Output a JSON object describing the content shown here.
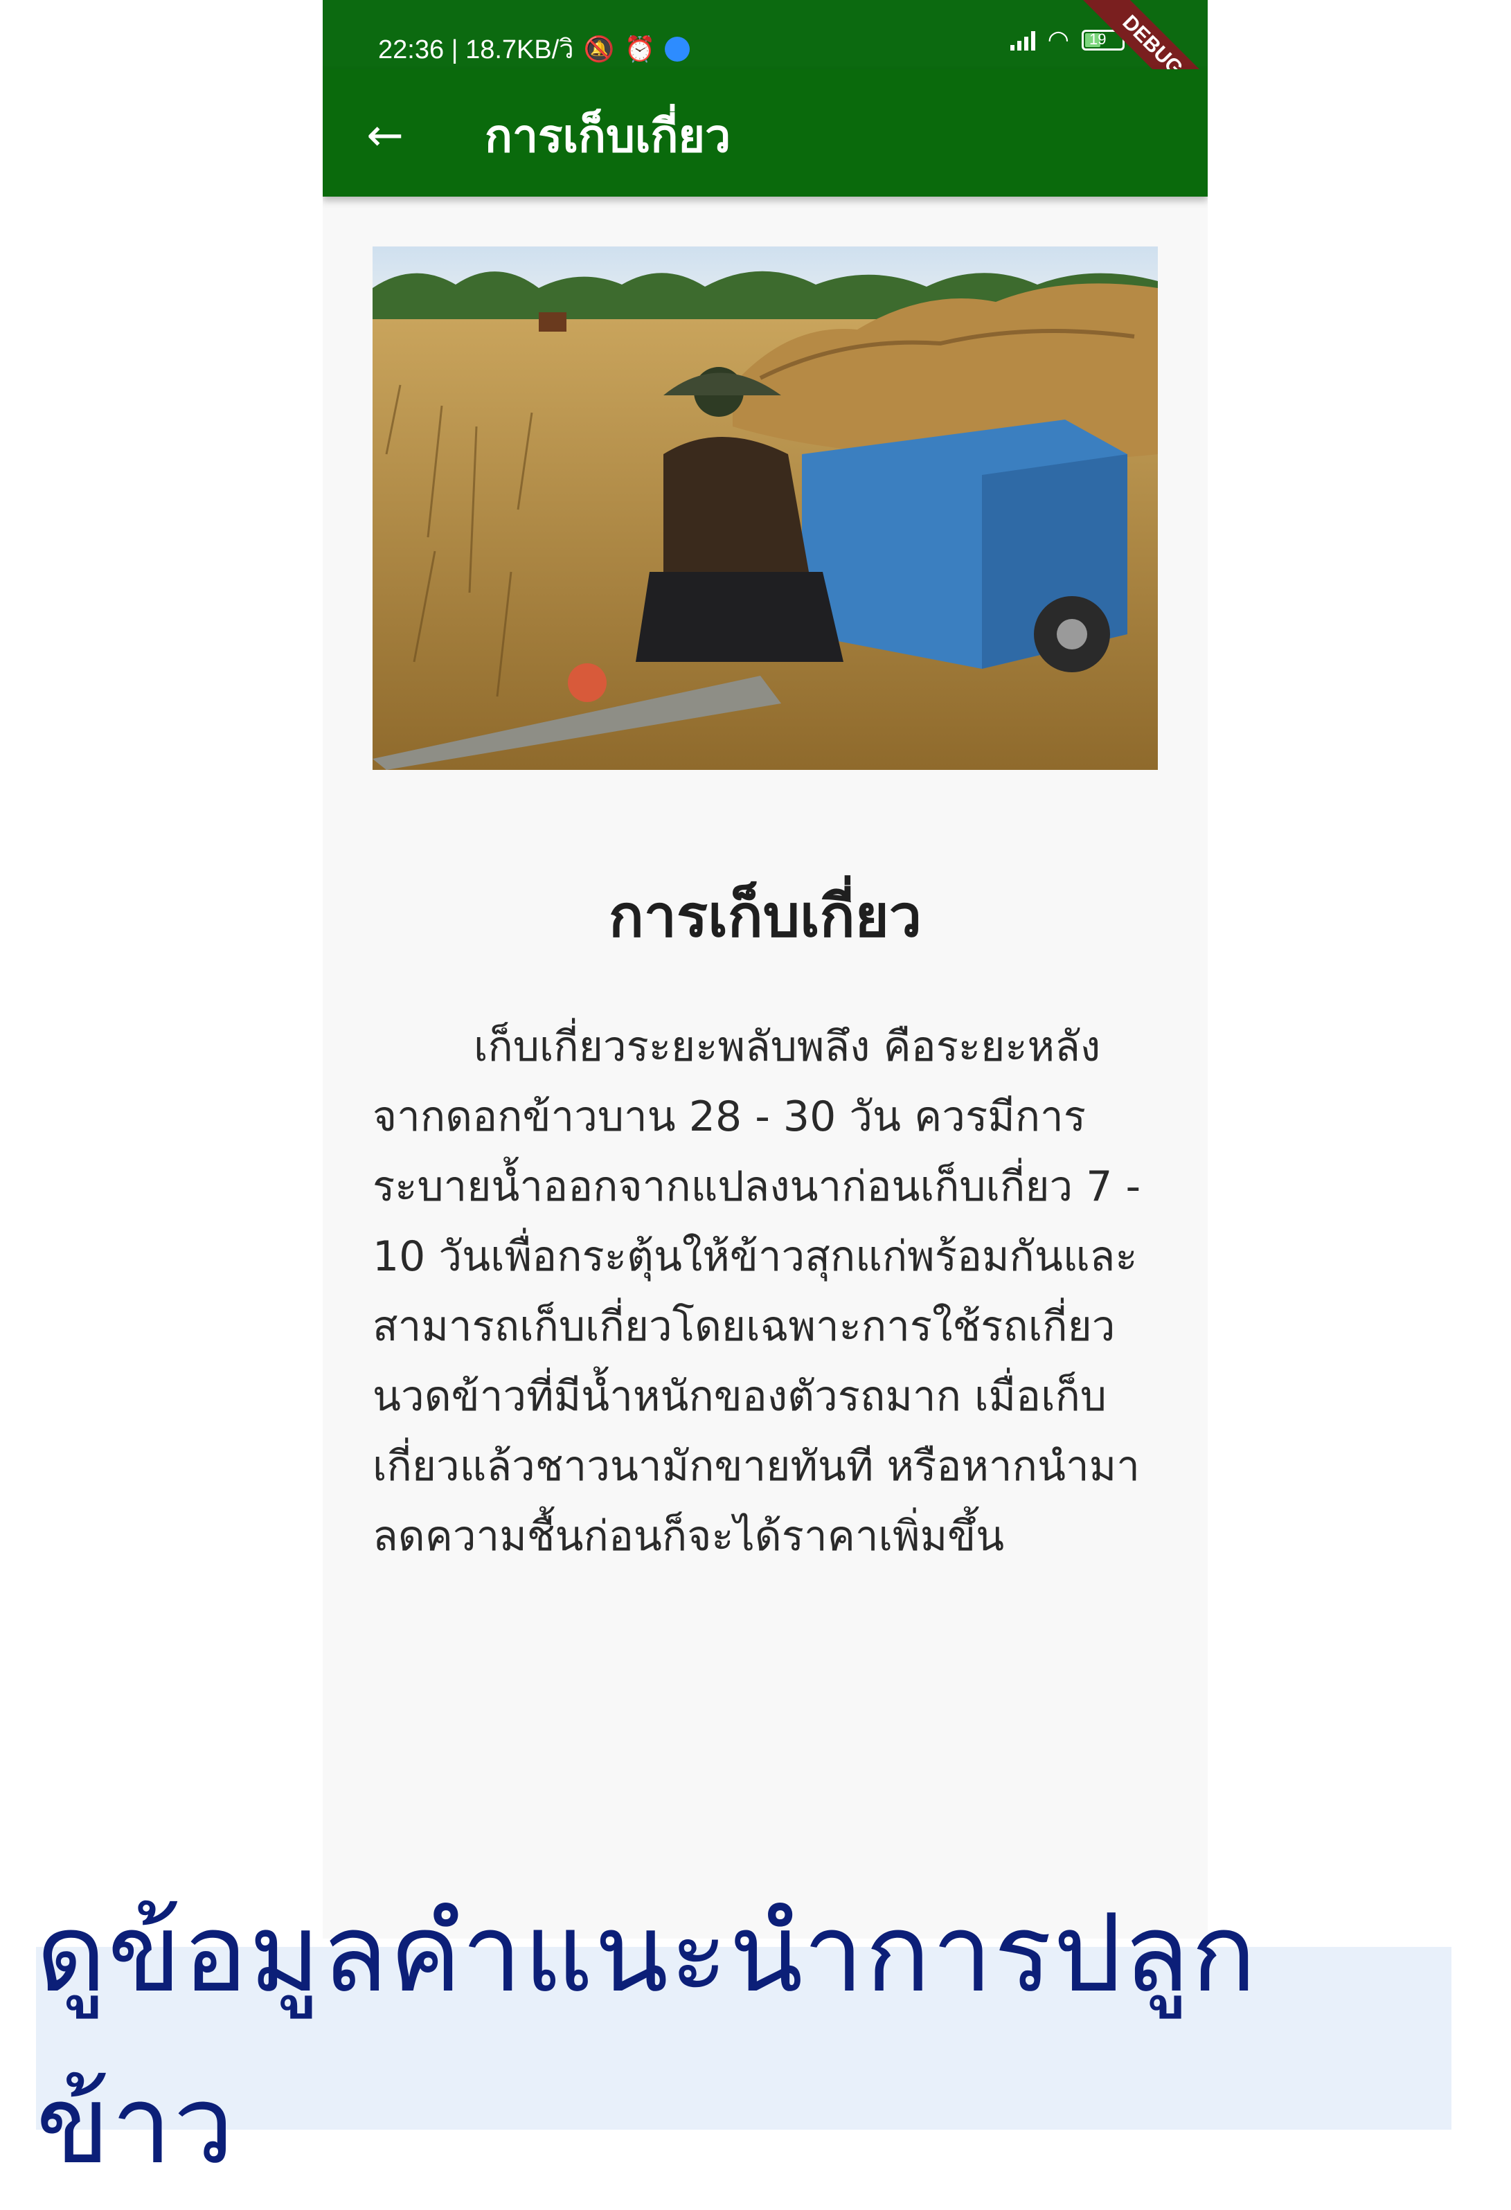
{
  "status_bar": {
    "time_info": "22:36 | 18.7KB/วิ",
    "battery": "19",
    "ribbon": "DEBUG"
  },
  "app_bar": {
    "back_icon": "arrow-left-icon",
    "title": "การเก็บเกี่ยว"
  },
  "content": {
    "title": "การเก็บเกี่ยว",
    "body": "เก็บเกี่ยวระยะพลับพลึง คือระยะหลังจากดอกข้าวบาน 28 - 30 วัน ควรมีการระบายน้ำออกจากแปลงนาก่อนเก็บเกี่ยว 7 - 10 วันเพื่อกระตุ้นให้ข้าวสุกแก่พร้อมกันและสามารถเก็บเกี่ยวโดยเฉพาะการใช้รถเกี่ยวนวดข้าวที่มีน้ำหนักของตัวรถมาก เมื่อเก็บเกี่ยวแล้วชาวนามักขายทันที หรือหากนำมาลดความชื้นก่อนก็จะได้ราคาเพิ่มขึ้น"
  },
  "banner": {
    "text": "ดูข้อมูลคำแนะนำการปลูกข้าว"
  },
  "colors": {
    "app_bar": "#0a6a0c",
    "banner_background": "#e8f0fa",
    "banner_text": "#0c1f78"
  }
}
